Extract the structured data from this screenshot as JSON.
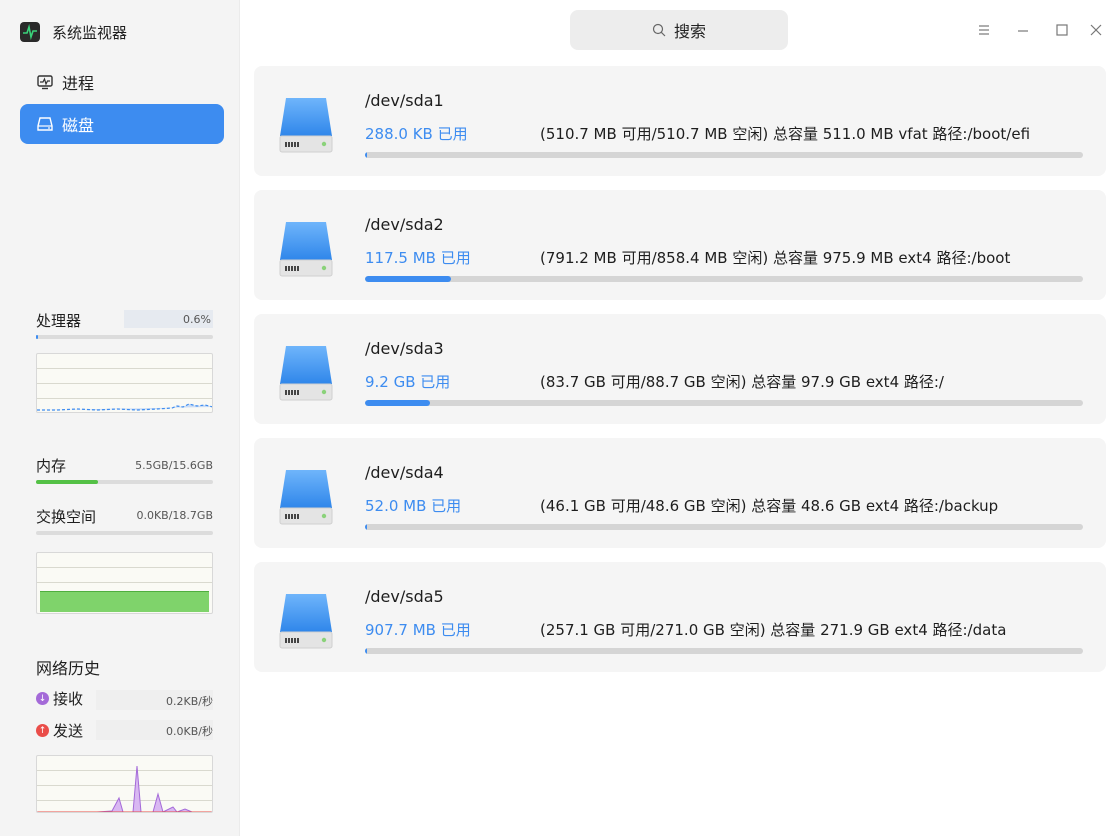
{
  "app": {
    "title": "系统监视器"
  },
  "nav": {
    "process_label": "进程",
    "disk_label": "磁盘"
  },
  "titlebar": {
    "search_label": "搜索"
  },
  "sidebar": {
    "cpu": {
      "label": "处理器",
      "value": "0.6%",
      "fraction": 0.006
    },
    "memory": {
      "label": "内存",
      "value": "5.5GB/15.6GB",
      "fraction": 0.35
    },
    "swap": {
      "label": "交换空间",
      "value": "0.0KB/18.7GB",
      "fraction": 0.0
    },
    "network": {
      "title": "网络历史",
      "receive_label": "接收",
      "receive_value": "0.2KB/秒",
      "send_label": "发送",
      "send_value": "0.0KB/秒"
    }
  },
  "colors": {
    "accent": "#3d8cf0",
    "memory": "#54c146",
    "receive": "#a46ad8",
    "send": "#ea4d49"
  },
  "disks": [
    {
      "name": "/dev/sda1",
      "used": "288.0 KB 已用",
      "info": "(510.7 MB 可用/510.7 MB 空闲) 总容量 511.0 MB  vfat  路径:/boot/efi",
      "fraction": 0.0006
    },
    {
      "name": "/dev/sda2",
      "used": "117.5 MB 已用",
      "info": "(791.2 MB 可用/858.4 MB 空闲) 总容量 975.9 MB  ext4  路径:/boot",
      "fraction": 0.12
    },
    {
      "name": "/dev/sda3",
      "used": "9.2 GB 已用",
      "info": "(83.7 GB 可用/88.7 GB 空闲) 总容量 97.9 GB  ext4  路径:/",
      "fraction": 0.09
    },
    {
      "name": "/dev/sda4",
      "used": "52.0 MB 已用",
      "info": "(46.1 GB 可用/48.6 GB 空闲) 总容量 48.6 GB  ext4  路径:/backup",
      "fraction": 0.001
    },
    {
      "name": "/dev/sda5",
      "used": "907.7 MB 已用",
      "info": "(257.1 GB 可用/271.0 GB 空闲) 总容量 271.9 GB  ext4  路径:/data",
      "fraction": 0.003
    }
  ]
}
